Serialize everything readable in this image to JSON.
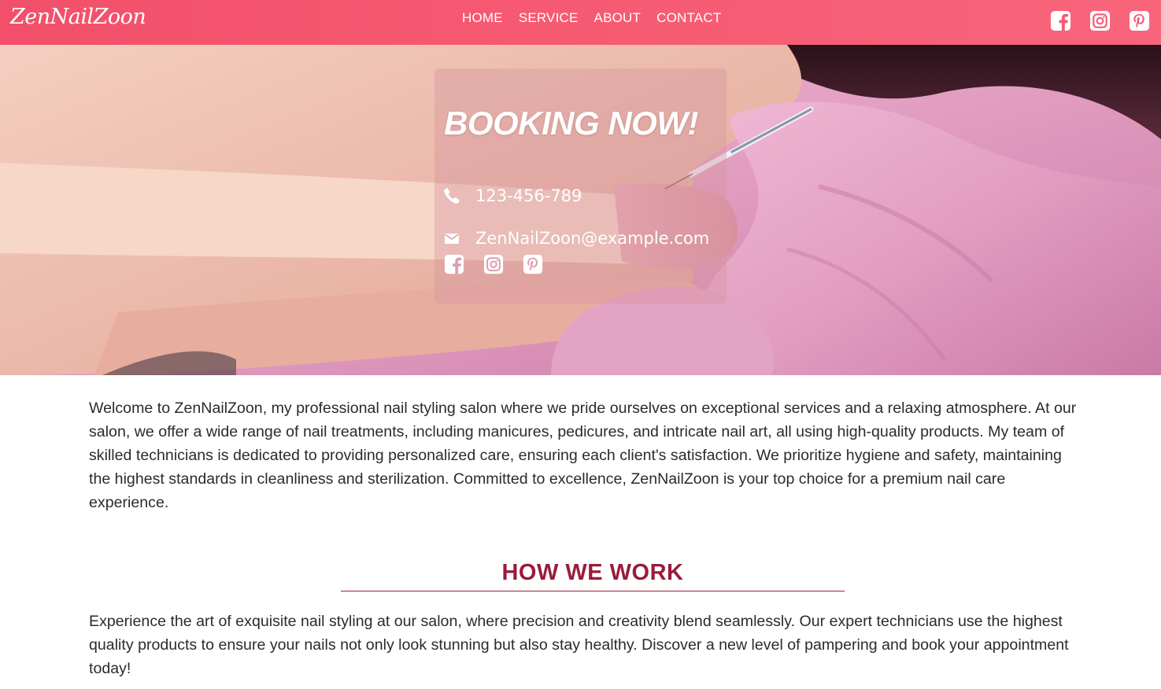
{
  "header": {
    "logo": "ZenNailZoon",
    "nav": [
      "HOME",
      "SERVICE",
      "ABOUT",
      "CONTACT"
    ],
    "social_icons": [
      "facebook-icon",
      "instagram-icon",
      "pinterest-icon"
    ]
  },
  "hero": {
    "title": "BOOKING NOW!",
    "phone": "123-456-789",
    "email": "ZenNailZoon@example.com",
    "social_icons": [
      "facebook-icon",
      "instagram-icon",
      "pinterest-icon"
    ]
  },
  "intro": {
    "text": "Welcome to ZenNailZoon, my professional nail styling salon where we pride ourselves on exceptional services and a relaxing atmosphere. At our salon, we offer a wide range of nail treatments, including manicures, pedicures, and intricate nail art, all using high-quality products. My team of skilled technicians is dedicated to providing personalized care, ensuring each client's satisfaction. We prioritize hygiene and safety, maintaining the highest standards in cleanliness and sterilization. Committed to excellence, ZenNailZoon is your top choice for a premium nail care experience."
  },
  "how_we_work": {
    "title": "HOW WE WORK",
    "text": "Experience the art of exquisite nail styling at our salon, where precision and creativity blend seamlessly. Our expert technicians use the highest quality products to ensure your nails not only look stunning but also stay healthy. Discover a new level of pampering and book your appointment today!"
  },
  "colors": {
    "header": "#f65a72",
    "heading": "#9a1c3a",
    "text": "#2b2b2b"
  }
}
